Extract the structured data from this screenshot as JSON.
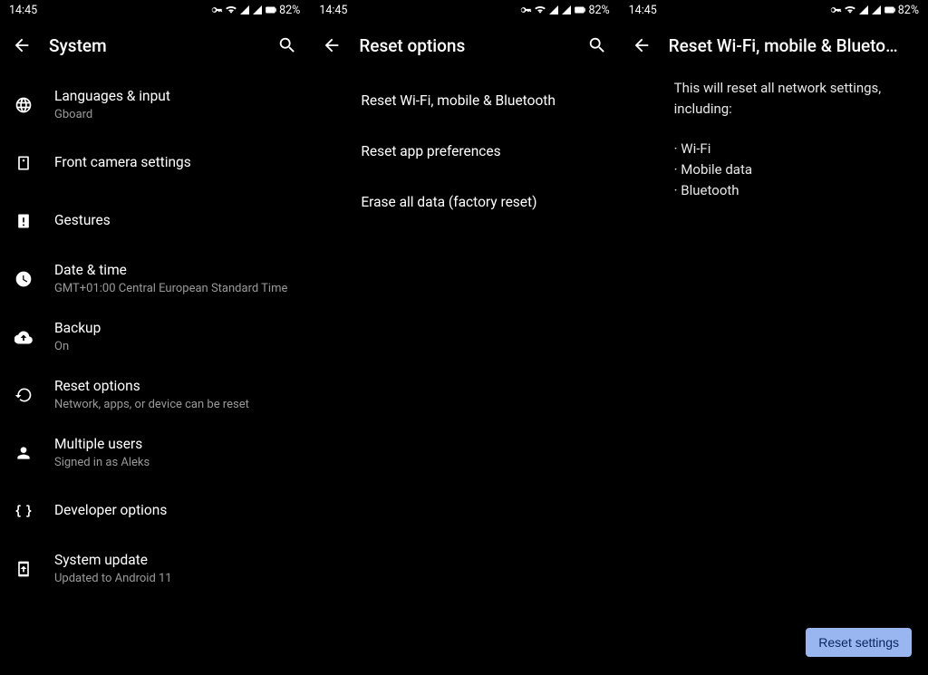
{
  "status": {
    "time": "14:45",
    "battery": "82%"
  },
  "panel1": {
    "title": "System",
    "items": [
      {
        "title": "Languages & input",
        "sub": "Gboard",
        "icon": "globe"
      },
      {
        "title": "Front camera settings",
        "sub": "",
        "icon": "frontcam"
      },
      {
        "title": "Gestures",
        "sub": "",
        "icon": "gestures"
      },
      {
        "title": "Date & time",
        "sub": "GMT+01:00 Central European Standard Time",
        "icon": "clock"
      },
      {
        "title": "Backup",
        "sub": "On",
        "icon": "cloud-up"
      },
      {
        "title": "Reset options",
        "sub": "Network, apps, or device can be reset",
        "icon": "restore"
      },
      {
        "title": "Multiple users",
        "sub": "Signed in as Aleks",
        "icon": "person"
      },
      {
        "title": "Developer options",
        "sub": "",
        "icon": "braces"
      },
      {
        "title": "System update",
        "sub": "Updated to Android 11",
        "icon": "sysupdate"
      }
    ]
  },
  "panel2": {
    "title": "Reset options",
    "items": [
      {
        "title": "Reset Wi-Fi, mobile & Bluetooth"
      },
      {
        "title": "Reset app preferences"
      },
      {
        "title": "Erase all data (factory reset)"
      }
    ]
  },
  "panel3": {
    "title": "Reset Wi-Fi, mobile & Blueto…",
    "intro": "This will reset all network settings, including:",
    "bullets": [
      "Wi-Fi",
      "Mobile data",
      "Bluetooth"
    ],
    "button": "Reset settings"
  }
}
